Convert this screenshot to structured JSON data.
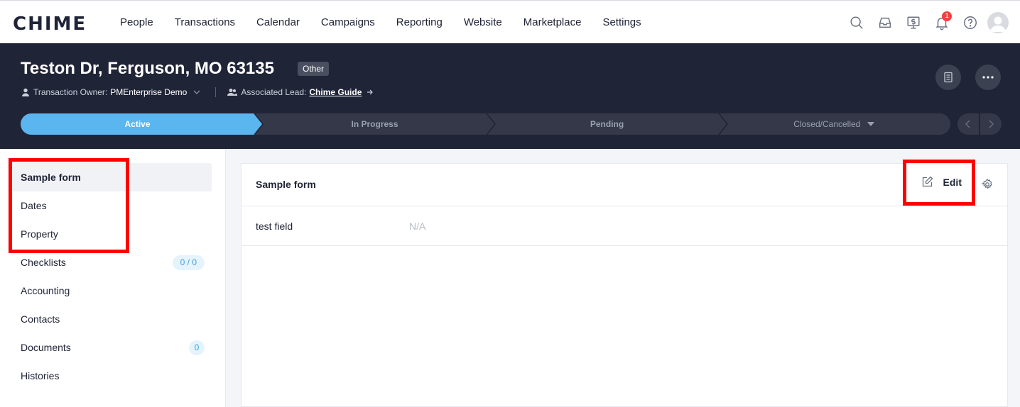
{
  "app": {
    "logo": "CHIME"
  },
  "nav": {
    "items": [
      "People",
      "Transactions",
      "Calendar",
      "Campaigns",
      "Reporting",
      "Website",
      "Marketplace",
      "Settings"
    ],
    "notification_count": "1"
  },
  "transaction": {
    "address": "Teston Dr, Ferguson, MO 63135",
    "type": "Other",
    "owner_label": "Transaction Owner:",
    "owner_name": "PMEnterprise Demo",
    "lead_label": "Associated Lead:",
    "lead_name": "Chime Guide"
  },
  "stages": [
    {
      "label": "Active",
      "state": "active"
    },
    {
      "label": "In Progress",
      "state": "inactive"
    },
    {
      "label": "Pending",
      "state": "inactive"
    },
    {
      "label": "Closed/Cancelled",
      "state": "inactive"
    }
  ],
  "sidebar": {
    "items": [
      {
        "label": "Sample form",
        "active": true,
        "count": ""
      },
      {
        "label": "Dates",
        "active": false,
        "count": ""
      },
      {
        "label": "Property",
        "active": false,
        "count": ""
      },
      {
        "label": "Checklists",
        "active": false,
        "count": "0 / 0"
      },
      {
        "label": "Accounting",
        "active": false,
        "count": ""
      },
      {
        "label": "Contacts",
        "active": false,
        "count": ""
      },
      {
        "label": "Documents",
        "active": false,
        "count": "0"
      },
      {
        "label": "Histories",
        "active": false,
        "count": ""
      }
    ]
  },
  "form": {
    "title": "Sample form",
    "edit_label": "Edit",
    "fields": [
      {
        "label": "test field",
        "value": "N/A"
      }
    ]
  },
  "colors": {
    "header_bg": "#202437",
    "stage_active": "#5bb5ee",
    "stage_inactive": "#343849",
    "highlight": "#ff0000"
  }
}
